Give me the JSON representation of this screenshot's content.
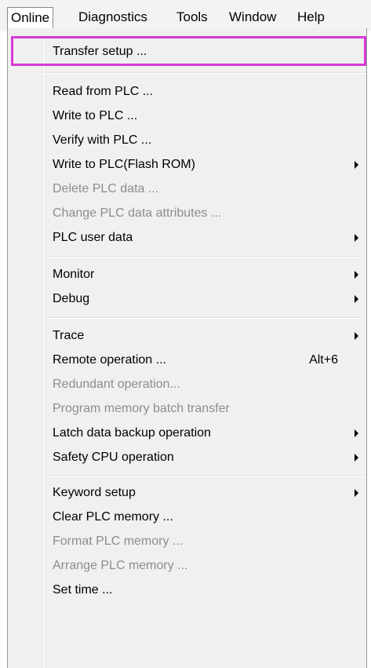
{
  "menubar": {
    "items": [
      "Online",
      "Diagnostics",
      "Tools",
      "Window",
      "Help"
    ]
  },
  "menu": {
    "items": [
      {
        "label": "Transfer setup ...",
        "enabled": true,
        "highlighted": true
      },
      {
        "label": "Read from PLC ...",
        "enabled": true
      },
      {
        "label": "Write to PLC ...",
        "enabled": true
      },
      {
        "label": "Verify with PLC ...",
        "enabled": true
      },
      {
        "label": "Write to PLC(Flash ROM)",
        "enabled": true,
        "submenu": true
      },
      {
        "label": "Delete PLC data ...",
        "enabled": false
      },
      {
        "label": "Change PLC data attributes ...",
        "enabled": false
      },
      {
        "label": "PLC user data",
        "enabled": true,
        "submenu": true
      },
      {
        "label": "Monitor",
        "enabled": true,
        "submenu": true
      },
      {
        "label": "Debug",
        "enabled": true,
        "submenu": true
      },
      {
        "label": "Trace",
        "enabled": true,
        "submenu": true
      },
      {
        "label": "Remote operation ...",
        "enabled": true,
        "shortcut": "Alt+6"
      },
      {
        "label": "Redundant operation...",
        "enabled": false
      },
      {
        "label": "Program memory batch transfer",
        "enabled": false
      },
      {
        "label": "Latch data backup operation",
        "enabled": true,
        "submenu": true
      },
      {
        "label": "Safety CPU operation",
        "enabled": true,
        "submenu": true
      },
      {
        "label": "Keyword setup",
        "enabled": true,
        "submenu": true
      },
      {
        "label": "Clear PLC memory ...",
        "enabled": true
      },
      {
        "label": "Format PLC memory ...",
        "enabled": false
      },
      {
        "label": "Arrange PLC memory ...",
        "enabled": false
      },
      {
        "label": "Set time ...",
        "enabled": true
      }
    ]
  },
  "colors": {
    "highlight_border": "#d63ad6",
    "disabled_text": "#8d8d8d",
    "menu_background": "#f0f0f0"
  }
}
